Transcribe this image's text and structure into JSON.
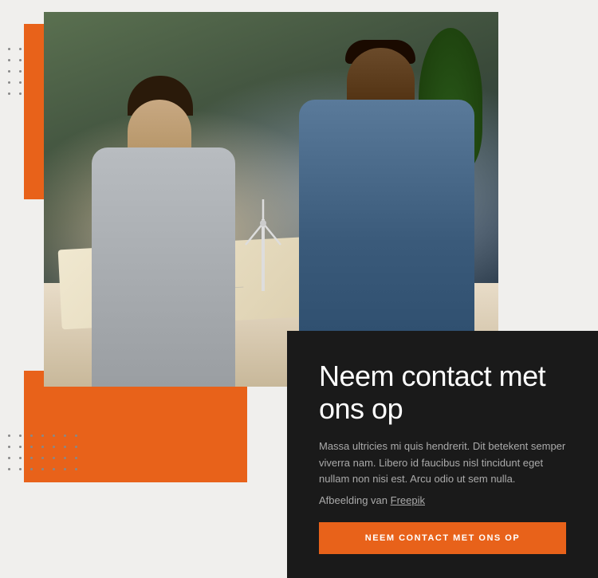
{
  "page": {
    "background_color": "#f0efed"
  },
  "hero": {
    "orange_accent_color": "#e8621a",
    "dark_box_color": "#1a1a1a"
  },
  "info_box": {
    "title": "Neem contact met ons op",
    "description": "Massa ultricies mi quis hendrerit. Dit betekent semper viverra nam. Libero id faucibus nisl tincidunt eget nullam non nisi est. Arcu odio ut sem nulla.",
    "attribution_text": "Afbeelding van",
    "attribution_link_text": "Freepik",
    "cta_label": "NEEM CONTACT MET ONS OP"
  },
  "dots": {
    "color": "#888888"
  }
}
